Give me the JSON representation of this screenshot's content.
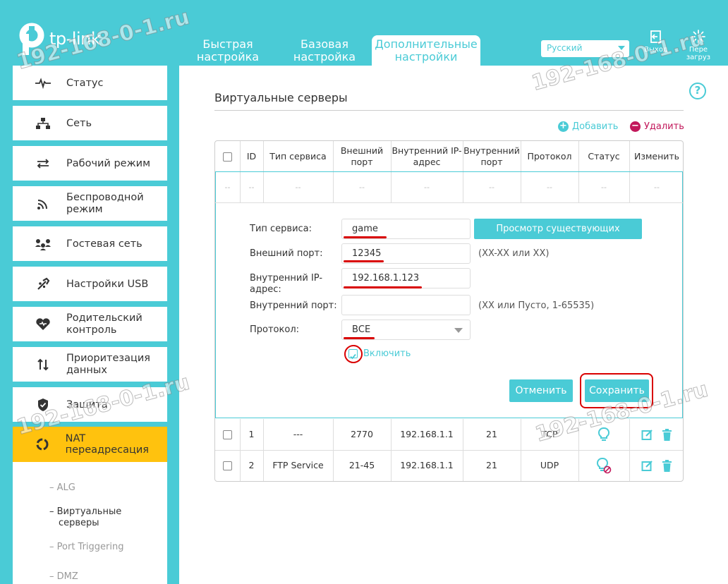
{
  "brand": {
    "logo_text": "tp-link"
  },
  "header": {
    "tabs": [
      {
        "label_line1": "Быстрая",
        "label_line2": "настройка"
      },
      {
        "label_line1": "Базовая",
        "label_line2": "настройка"
      },
      {
        "label_line1": "Дополнительные",
        "label_line2": "настройки"
      }
    ],
    "language": "Русский",
    "logout_label": "Выход",
    "reboot_line1": "Пере",
    "reboot_line2": "загруз"
  },
  "watermark": "192-168-0-1.ru",
  "sidebar": {
    "items": [
      {
        "label": "Статус",
        "icon": "pulse-icon"
      },
      {
        "label": "Сеть",
        "icon": "network-icon"
      },
      {
        "label": "Рабочий режим",
        "icon": "mode-switch-icon"
      },
      {
        "label_line1": "Беспроводной",
        "label_line2": "режим",
        "icon": "wifi-icon"
      },
      {
        "label": "Гостевая сеть",
        "icon": "guests-icon"
      },
      {
        "label": "Настройки USB",
        "icon": "usb-icon"
      },
      {
        "label_line1": "Родительский",
        "label_line2": "контроль",
        "icon": "heart-icon"
      },
      {
        "label_line1": "Приоритезация",
        "label_line2": "данных",
        "icon": "priority-arrows-icon"
      },
      {
        "label": "Защита",
        "icon": "shield-icon"
      },
      {
        "label": "NAT переадресация",
        "icon": "nat-icon"
      }
    ],
    "submenu": [
      {
        "label": "ALG"
      },
      {
        "label_line1": "Виртуальные",
        "label_line2": "серверы"
      },
      {
        "label": "Port Triggering"
      },
      {
        "label": "DMZ"
      }
    ]
  },
  "main": {
    "help_glyph": "?",
    "title": "Виртуальные серверы",
    "add_label": "Добавить",
    "delete_label": "Удалить",
    "columns": {
      "id": "ID",
      "service": "Тип сервиса",
      "ext_line1": "Внешний",
      "ext_line2": "порт",
      "ip_line1": "Внутренний IP-",
      "ip_line2": "адрес",
      "int_line1": "Внутренний",
      "int_line2": "порт",
      "protocol": "Протокол",
      "status": "Статус",
      "edit": "Изменить"
    },
    "placeholder_cell": "--",
    "form": {
      "service_label": "Тип сервиса:",
      "service_value": "game",
      "view_services_button": "Просмотр существующих сервисов",
      "ext_port_label": "Внешний порт:",
      "ext_port_value": "12345",
      "ext_port_hint": "(XX-XX или XX)",
      "ip_label_line1": "Внутренний IP-",
      "ip_label_line2": "адрес:",
      "ip_value": "192.168.1.123",
      "int_port_label": "Внутренний порт:",
      "int_port_value": "",
      "int_port_hint": "(XX или Пусто, 1-65535)",
      "protocol_label": "Протокол:",
      "protocol_value": "ВСЕ",
      "enable_label": "Включить",
      "enable_checked": true,
      "cancel_button": "Отменить",
      "save_button": "Сохранить"
    },
    "rows": [
      {
        "id": "1",
        "service": "---",
        "ext_port": "2770",
        "ip": "192.168.1.1",
        "int_port": "21",
        "protocol": "TCP",
        "status": "enabled"
      },
      {
        "id": "2",
        "service": "FTP Service",
        "ext_port": "21-45",
        "ip": "192.168.1.1",
        "int_port": "21",
        "protocol": "UDP",
        "status": "disabled"
      }
    ]
  },
  "colors": {
    "accent": "#4acbd6",
    "active_menu": "#ffc20e",
    "delete_red": "#c2185b",
    "annotation_red": "#d90000"
  }
}
